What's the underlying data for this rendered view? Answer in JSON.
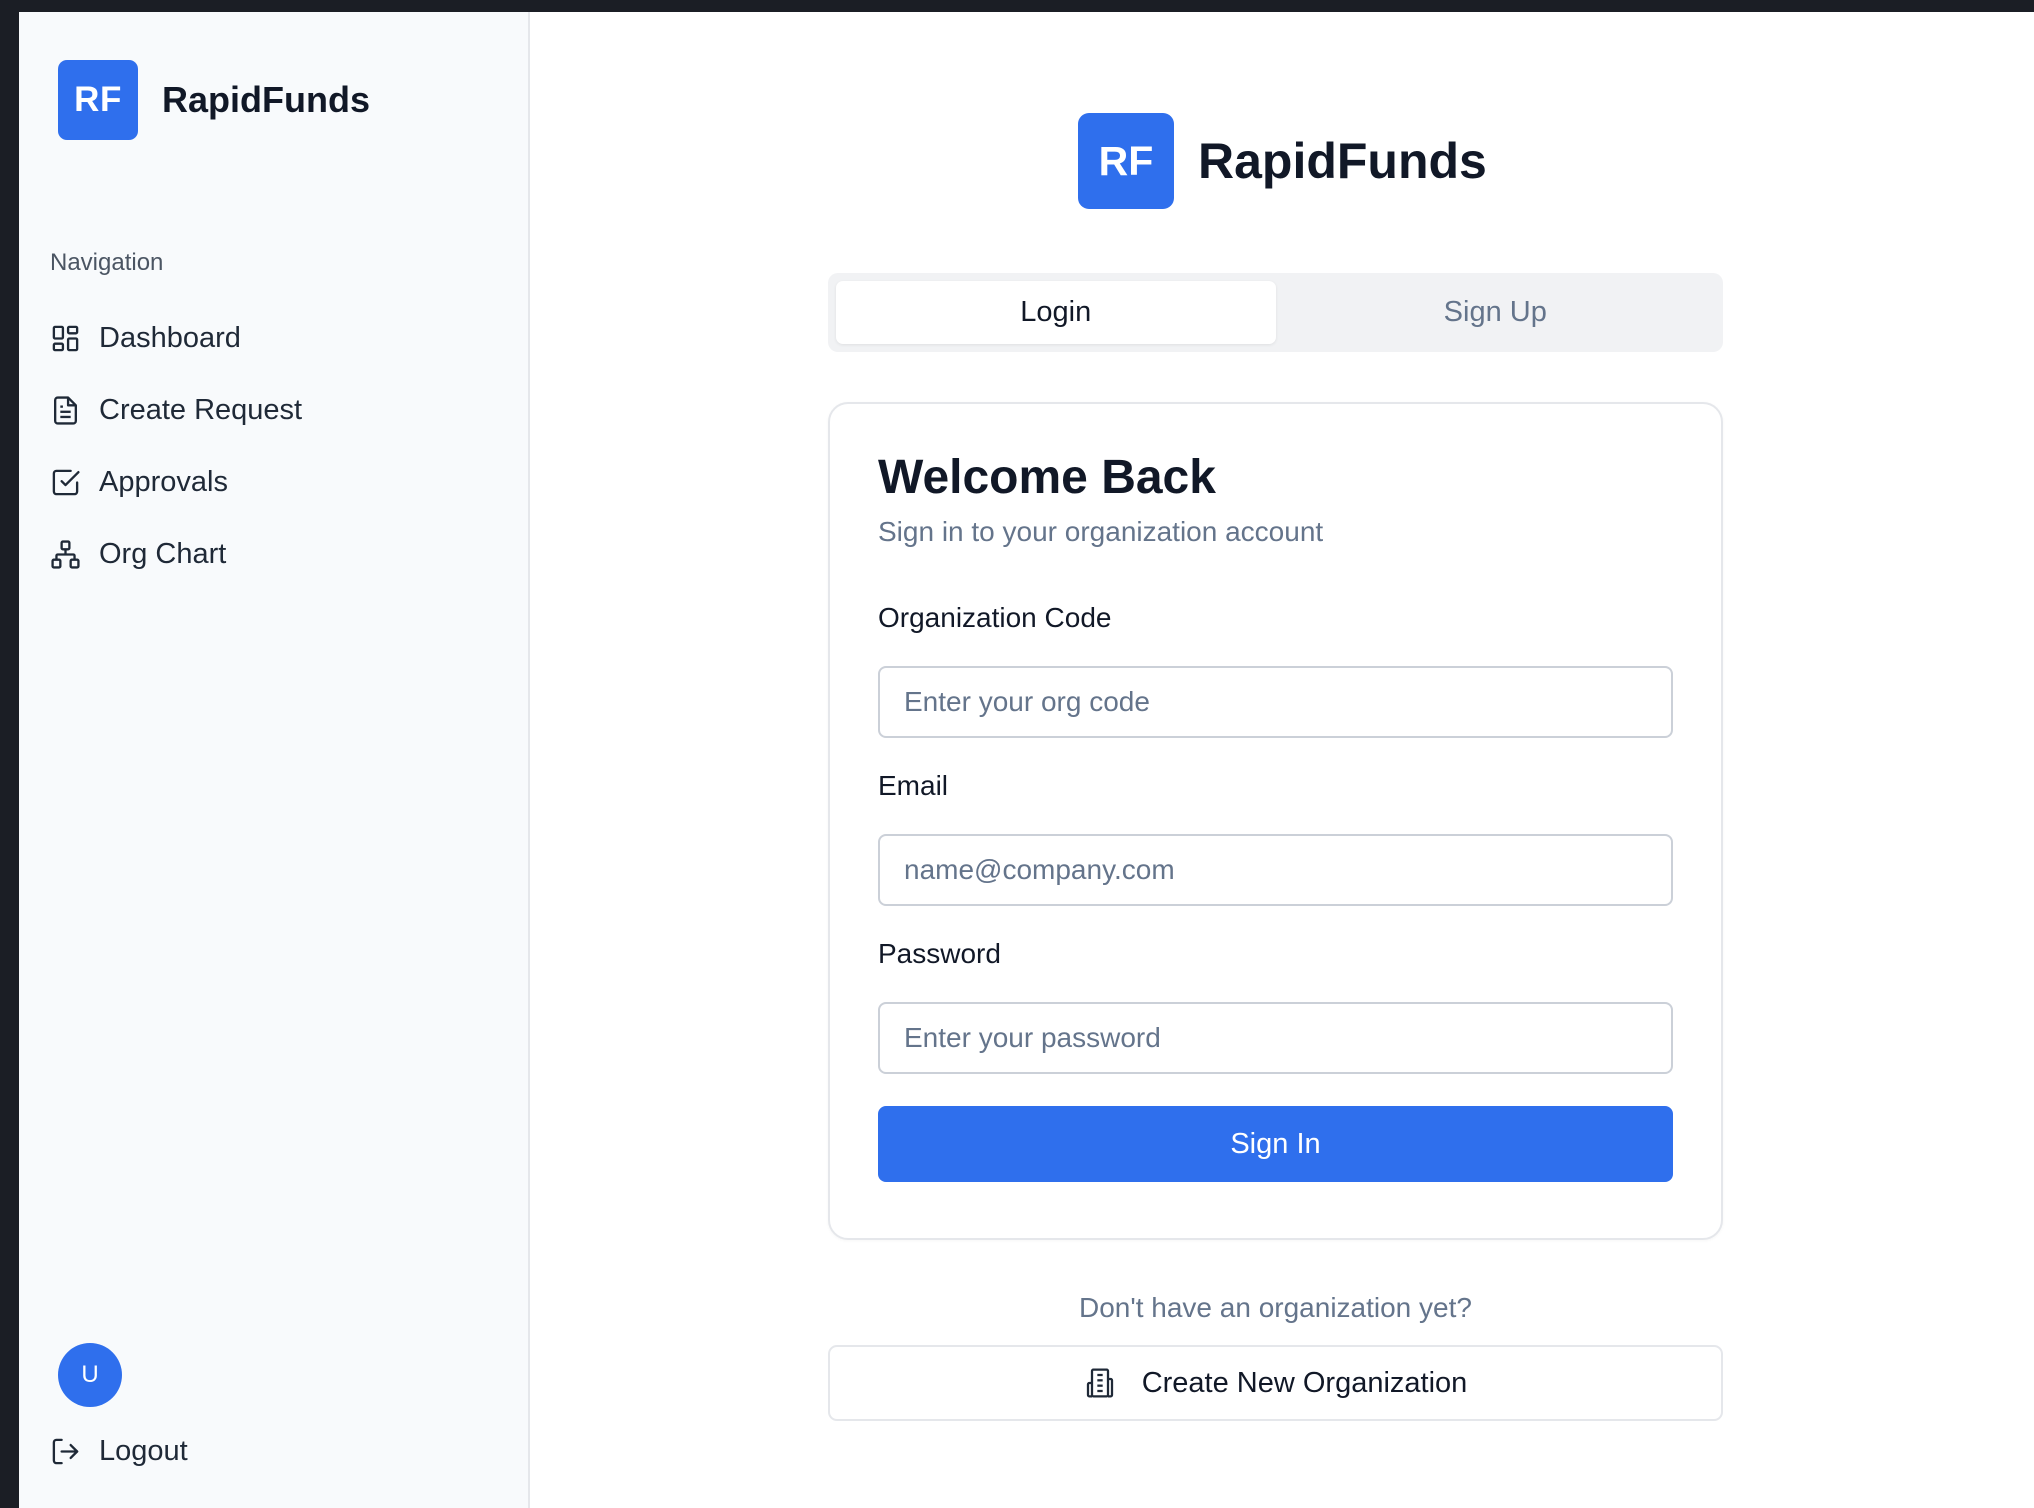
{
  "app": {
    "logo_initials": "RF",
    "name": "RapidFunds",
    "accent_color": "#2f6fed"
  },
  "sidebar": {
    "heading": "Navigation",
    "items": [
      {
        "label": "Dashboard",
        "icon": "dashboard-grid-icon"
      },
      {
        "label": "Create Request",
        "icon": "document-icon"
      },
      {
        "label": "Approvals",
        "icon": "checkbox-icon"
      },
      {
        "label": "Org Chart",
        "icon": "org-chart-icon"
      }
    ],
    "avatar_initial": "U",
    "logout_label": "Logout"
  },
  "auth": {
    "tabs": [
      {
        "label": "Login",
        "active": true
      },
      {
        "label": "Sign Up",
        "active": false
      }
    ],
    "title": "Welcome Back",
    "subtitle": "Sign in to your organization account",
    "fields": {
      "org_code": {
        "label": "Organization Code",
        "placeholder": "Enter your org code",
        "value": ""
      },
      "email": {
        "label": "Email",
        "placeholder": "name@company.com",
        "value": ""
      },
      "password": {
        "label": "Password",
        "placeholder": "Enter your password",
        "value": ""
      }
    },
    "submit_label": "Sign In",
    "no_org_text": "Don't have an organization yet?",
    "create_org_label": "Create New Organization"
  }
}
